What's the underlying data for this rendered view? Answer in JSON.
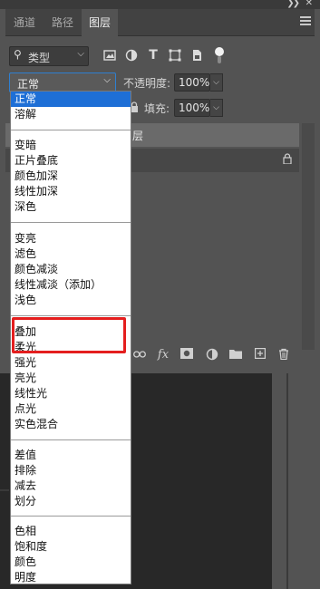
{
  "window": {
    "collapse_icon": "double-chevron-right-icon",
    "close_icon": "close-icon"
  },
  "tabs": [
    {
      "label": "通道",
      "active": false
    },
    {
      "label": "路径",
      "active": false
    },
    {
      "label": "图层",
      "active": true
    }
  ],
  "filter": {
    "kind_label": "类型",
    "icons": [
      "image-filter-icon",
      "adjustment-filter-icon",
      "type-filter-icon",
      "shape-filter-icon",
      "smart-object-filter-icon",
      "filter-toggle-icon"
    ]
  },
  "blend": {
    "current": "正常",
    "opacity_label": "不透明度:",
    "opacity_value": "100%",
    "fill_label": "填充:",
    "fill_value": "100%"
  },
  "layers": {
    "header_text": "层"
  },
  "bottom_toolbar": {
    "icons": [
      "link-icon",
      "fx-icon",
      "mask-icon",
      "adjustment-layer-icon",
      "group-folder-icon",
      "new-layer-icon",
      "trash-icon"
    ],
    "fx_label": "fx"
  },
  "blend_menu": {
    "groups": [
      [
        "正常",
        "溶解"
      ],
      [
        "变暗",
        "正片叠底",
        "颜色加深",
        "线性加深",
        "深色"
      ],
      [
        "变亮",
        "滤色",
        "颜色减淡",
        "线性减淡（添加）",
        "浅色"
      ],
      [
        "叠加",
        "柔光",
        "强光",
        "亮光",
        "线性光",
        "点光",
        "实色混合"
      ],
      [
        "差值",
        "排除",
        "减去",
        "划分"
      ],
      [
        "色相",
        "饱和度",
        "颜色",
        "明度"
      ]
    ],
    "selected": "正常",
    "highlighted": [
      "叠加",
      "柔光"
    ],
    "selected_color": "#1e6fd6",
    "highlight_color": "#e41e1e"
  }
}
